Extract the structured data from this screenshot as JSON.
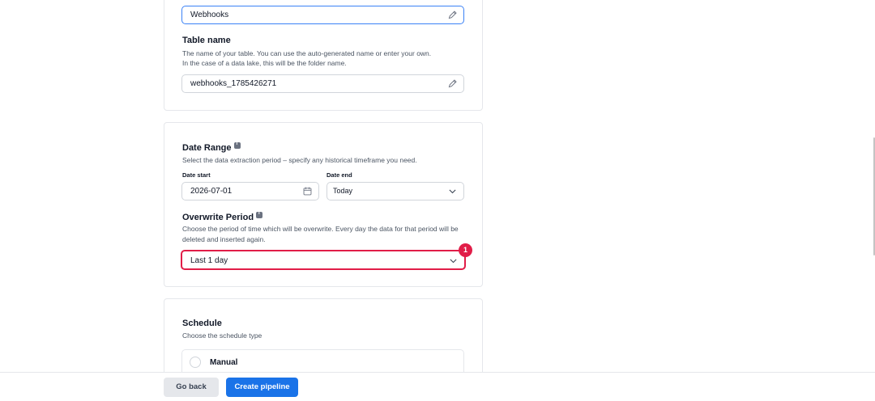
{
  "pipeline_name": {
    "value": "Webhooks"
  },
  "table_name": {
    "heading": "Table name",
    "description_line1": "The name of your table. You can use the auto-generated name or enter your own.",
    "description_line2": "In the case of a data lake, this will be the folder name.",
    "value": "webhooks_1785426271"
  },
  "date_range": {
    "heading": "Date Range",
    "description": "Select the data extraction period – specify any historical timeframe you need.",
    "start_label": "Date start",
    "start_value": "2026-07-01",
    "end_label": "Date end",
    "end_value": "Today"
  },
  "overwrite_period": {
    "heading": "Overwrite Period",
    "description_line1": "Choose the period of time which will be overwrite. Every day the data for that period will be",
    "description_line2": "deleted and inserted again.",
    "value": "Last 1 day",
    "badge": "1"
  },
  "schedule": {
    "heading": "Schedule",
    "description": "Choose the schedule type",
    "options": [
      {
        "label": "Manual"
      }
    ]
  },
  "footer": {
    "back_label": "Go back",
    "create_label": "Create pipeline"
  },
  "colors": {
    "accent": "#1a73e8",
    "error": "#e11d48",
    "focus": "#3b82f6"
  }
}
